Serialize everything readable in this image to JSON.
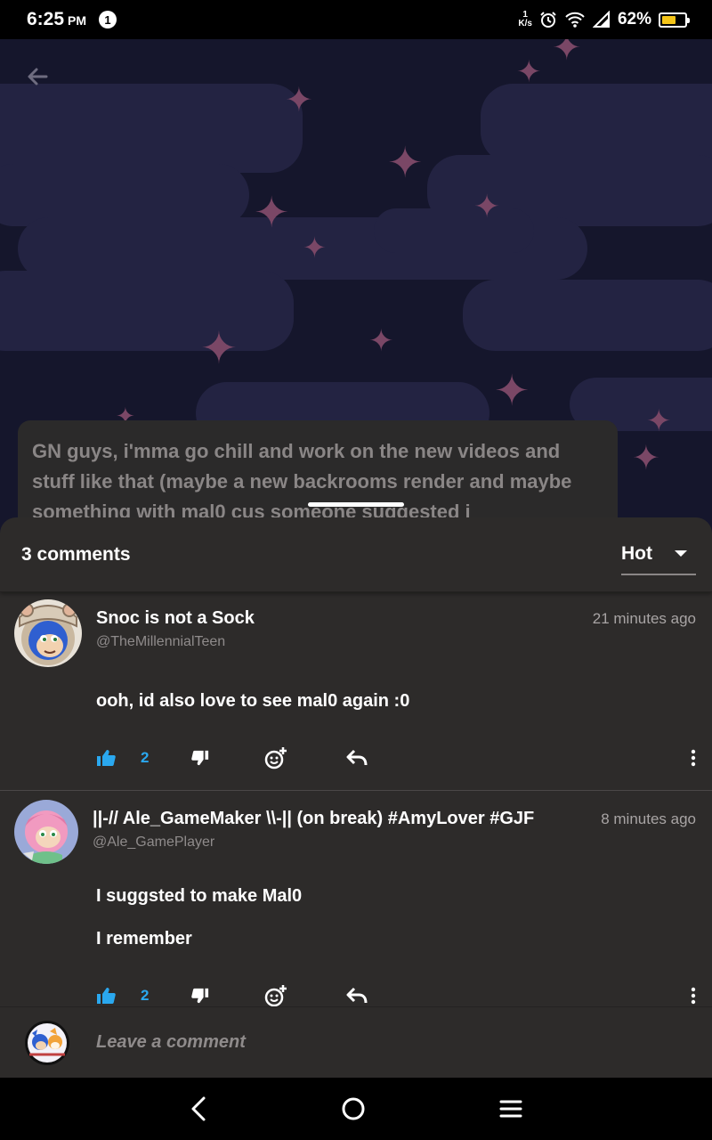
{
  "status_bar": {
    "time": "6:25",
    "ampm": "PM",
    "notification_count": "1",
    "net_speed_value": "1",
    "net_speed_unit": "K/s",
    "battery_percent": "62%",
    "battery_level": 0.62,
    "battery_color": "#f5c518",
    "icons": [
      "alarm-icon",
      "wifi-icon",
      "signal-icon",
      "battery-icon"
    ]
  },
  "post": {
    "text": "GN guys, i'mma go chill and work on the new videos and stuff like that (maybe a new backrooms render and maybe something with mal0 cus someone suggested i"
  },
  "comments_sheet": {
    "count_label": "3 comments",
    "sort_value": "Hot",
    "comments": [
      {
        "author": "Snoc is not a Sock",
        "handle": "@TheMillennialTeen",
        "timestamp": "21 minutes ago",
        "body": [
          "ooh, id also love to see mal0 again :0"
        ],
        "likes": "2"
      },
      {
        "author": "||-// Ale_GameMaker \\\\-|| (on break) #AmyLover #GJF",
        "handle": "@Ale_GamePlayer",
        "timestamp": "8 minutes ago",
        "body": [
          "I suggsted to make Mal0",
          "I remember"
        ],
        "likes": "2"
      }
    ]
  },
  "composer": {
    "placeholder": "Leave a comment"
  },
  "colors": {
    "sheet_bg": "#2d2b2a",
    "like_accent": "#2aa8ef",
    "banner_bg": "#15162c",
    "star": "#7a4766"
  }
}
